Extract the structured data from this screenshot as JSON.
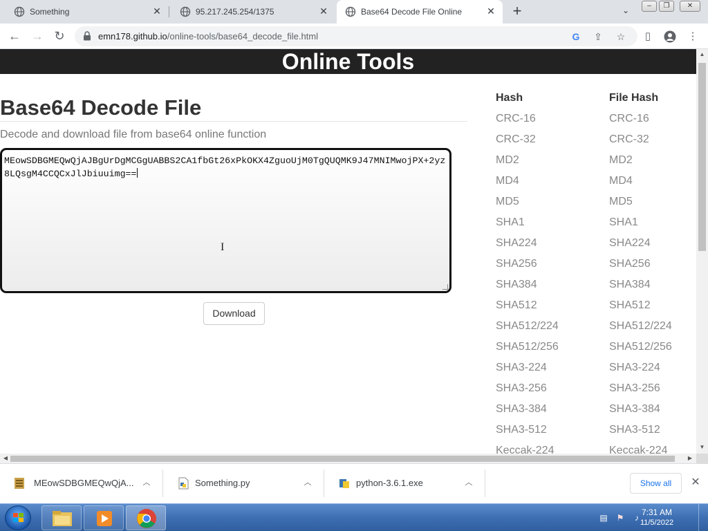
{
  "browser": {
    "tabs": [
      {
        "title": "Something",
        "active": false
      },
      {
        "title": "95.217.245.254/1375",
        "active": false
      },
      {
        "title": "Base64 Decode File Online",
        "active": true
      }
    ],
    "new_tab_label": "+",
    "url_host": "emn178.github.io",
    "url_path": "/online-tools/base64_decode_file.html"
  },
  "page": {
    "site_title": "Online Tools",
    "title": "Base64 Decode File",
    "subtitle": "Decode and download file from base64 online function",
    "input_value": "MEowSDBGMEQwQjAJBgUrDgMCGgUABBS2CA1fbGt26xPkOKX4ZguoUjM0TgQUQMK9J47MNIMwojPX+2yz8LQsgM4CCQCxJlJbiuuimg==",
    "download_label": "Download",
    "hash_column": {
      "heading": "Hash",
      "items": [
        "CRC-16",
        "CRC-32",
        "MD2",
        "MD4",
        "MD5",
        "SHA1",
        "SHA224",
        "SHA256",
        "SHA384",
        "SHA512",
        "SHA512/224",
        "SHA512/256",
        "SHA3-224",
        "SHA3-256",
        "SHA3-384",
        "SHA3-512",
        "Keccak-224"
      ]
    },
    "file_hash_column": {
      "heading": "File Hash",
      "items": [
        "CRC-16",
        "CRC-32",
        "MD2",
        "MD4",
        "MD5",
        "SHA1",
        "SHA224",
        "SHA256",
        "SHA384",
        "SHA512",
        "SHA512/224",
        "SHA512/256",
        "SHA3-224",
        "SHA3-256",
        "SHA3-384",
        "SHA3-512",
        "Keccak-224"
      ]
    }
  },
  "downloads": {
    "items": [
      {
        "name": "MEowSDBGMEQwQjA..."
      },
      {
        "name": "Something.py"
      },
      {
        "name": "python-3.6.1.exe"
      }
    ],
    "show_all_label": "Show all"
  },
  "taskbar": {
    "time": "7:31 AM",
    "date": "11/5/2022"
  }
}
